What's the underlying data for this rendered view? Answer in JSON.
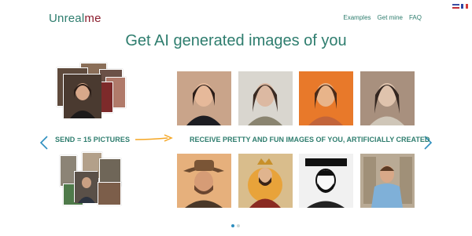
{
  "brand": {
    "name_part1": "Unreal",
    "name_part2": "me"
  },
  "nav": {
    "examples": "Examples",
    "get_mine": "Get mine",
    "faq": "FAQ"
  },
  "headline": "Get AI generated images of you",
  "send_label": "SEND = 15 PICTURES",
  "receive_label": "RECEIVE PRETTY AND FUN IMAGES OF YOU, ARTIFICIALLY CREATED",
  "carousel": {
    "pages": 2,
    "current": 1
  },
  "colors": {
    "brand": "#2e7d6e",
    "brand_accent": "#8b1e2e",
    "arrow": "#f5a623",
    "dot_active": "#2e8fbf"
  },
  "icons": {
    "prev": "chevron-left-icon",
    "next": "chevron-right-icon",
    "flow": "right-arrow-icon"
  }
}
